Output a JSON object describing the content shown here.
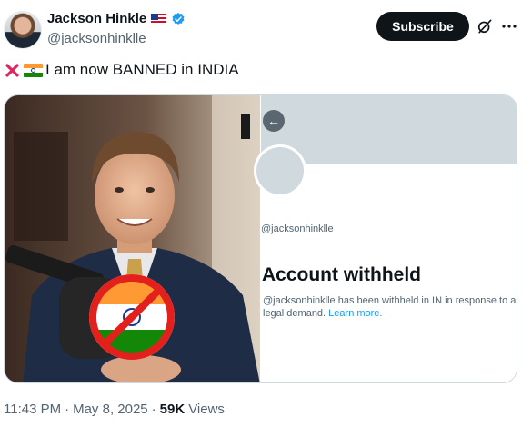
{
  "author": {
    "name": "Jackson Hinkle",
    "handle": "@jacksonhinklle",
    "flag_icon": "us-flag-icon",
    "verified_icon": "verified-badge-icon",
    "verified_color": "#1d9bf0"
  },
  "actions": {
    "subscribe_label": "Subscribe",
    "grok_icon": "grok-icon",
    "more_icon": "more-options-icon"
  },
  "post": {
    "text": "I am now BANNED in INDIA",
    "prefix_icons": [
      "cross-mark-icon",
      "india-flag-icon"
    ]
  },
  "media": {
    "left_image": "photo-man-with-crossed-out-india-flag",
    "right_image": {
      "handle": "@jacksonhinklle",
      "title": "Account withheld",
      "body": "@jacksonhinklle has been withheld in IN in response to a legal demand.",
      "link": "Learn more."
    }
  },
  "meta": {
    "time": "11:43 PM",
    "separator": "·",
    "date": "May 8, 2025",
    "views_count": "59K",
    "views_label": "Views"
  },
  "colors": {
    "text": "#0f1419",
    "secondary": "#536471",
    "accent": "#1d9bf0",
    "button_bg": "#0f1419"
  }
}
